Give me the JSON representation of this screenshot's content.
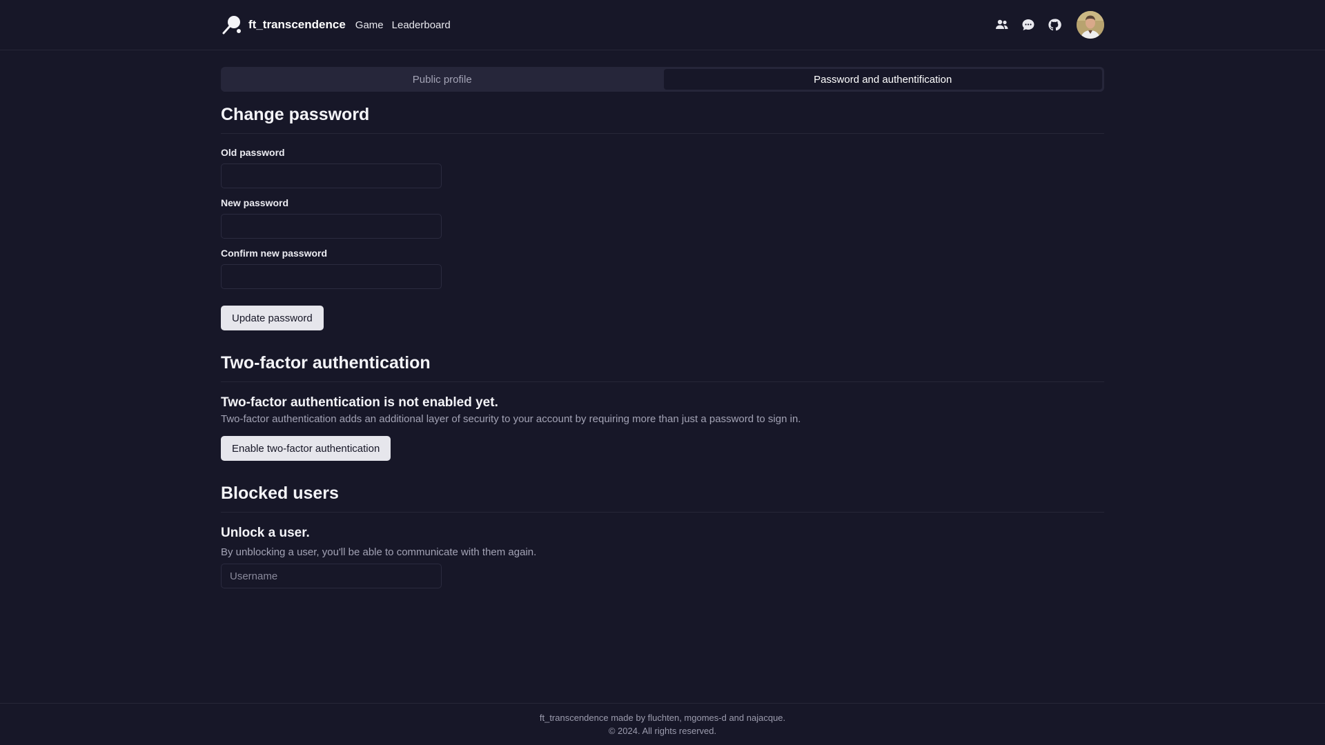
{
  "header": {
    "brand": "ft_transcendence",
    "nav": [
      {
        "label": "Game"
      },
      {
        "label": "Leaderboard"
      }
    ],
    "icons": [
      "friends-icon",
      "chat-icon",
      "github-icon"
    ]
  },
  "tabs": [
    {
      "label": "Public profile",
      "active": false
    },
    {
      "label": "Password and authentification",
      "active": true
    }
  ],
  "change_password": {
    "title": "Change password",
    "old_label": "Old password",
    "new_label": "New password",
    "confirm_label": "Confirm new password",
    "button": "Update password"
  },
  "two_factor": {
    "title": "Two-factor authentication",
    "status": "Two-factor authentication is not enabled yet.",
    "description": "Two-factor authentication adds an additional layer of security to your account by requiring more than just a password to sign in.",
    "button": "Enable two-factor authentication"
  },
  "blocked": {
    "title": "Blocked users",
    "subtitle": "Unlock a user.",
    "description": "By unblocking a user, you'll be able to communicate with them again.",
    "placeholder": "Username"
  },
  "footer": {
    "line1": "ft_transcendence made by fluchten, mgomes-d and najacque.",
    "line2": "© 2024. All rights reserved."
  },
  "colors": {
    "background": "#171728",
    "border": "#272738",
    "tab_bar": "#26263a",
    "button_bg": "#e6e6ec",
    "muted_text": "#a3a3b5"
  }
}
